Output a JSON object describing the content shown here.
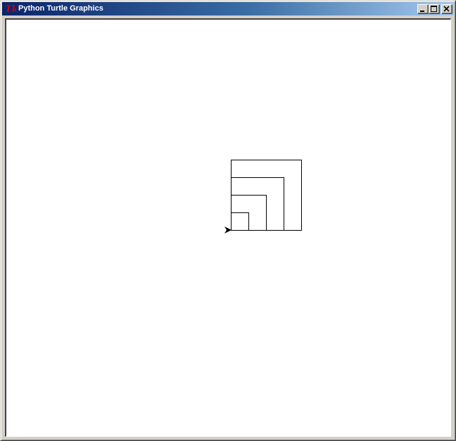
{
  "window": {
    "title": "Python Turtle Graphics",
    "app_icon": "tk-icon"
  },
  "title_bar_buttons": [
    {
      "name": "minimize",
      "icon": "minimize-icon"
    },
    {
      "name": "maximize",
      "icon": "maximize-icon"
    },
    {
      "name": "close",
      "icon": "close-icon"
    }
  ],
  "canvas": {
    "background": "#ffffff",
    "pen_color": "#000000",
    "turtle_shape": "arrow-cursor-icon",
    "turtle_heading": "east",
    "nested_squares_count": 4
  },
  "colors": {
    "title_gradient_start": "#0a246a",
    "title_gradient_end": "#a6caf0",
    "chrome": "#d4d0c8"
  }
}
